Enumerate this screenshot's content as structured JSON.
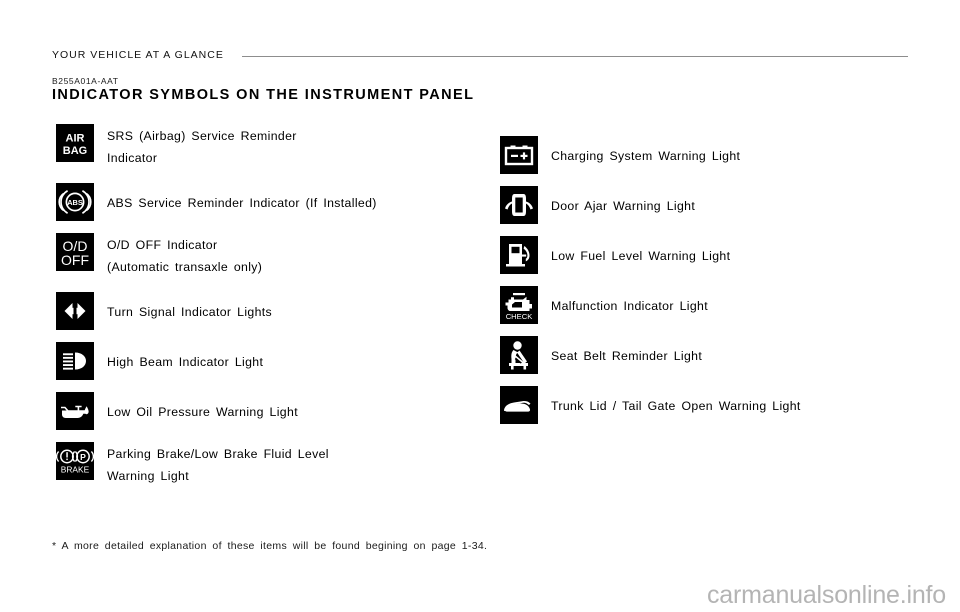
{
  "header": {
    "running_head": "YOUR VEHICLE AT A GLANCE",
    "section_code": "B255A01A-AAT",
    "section_title": "INDICATOR  SYMBOLS  ON  THE  INSTRUMENT  PANEL"
  },
  "left_column": [
    {
      "icon": "air-bag-icon",
      "icon_text_line1": "AIR",
      "icon_text_line2": "BAG",
      "label": "SRS  (Airbag)  Service  Reminder\nIndicator",
      "lines": 2
    },
    {
      "icon": "abs-icon",
      "icon_text_line1": "ABS",
      "label": "ABS  Service  Reminder  Indicator  (If  Installed)",
      "lines": 1
    },
    {
      "icon": "od-off-icon",
      "icon_text_line1": "O/D",
      "icon_text_line2": "OFF",
      "label": "O/D  OFF  Indicator\n(Automatic  transaxle  only)",
      "lines": 2
    },
    {
      "icon": "turn-signal-icon",
      "label": "Turn  Signal  Indicator  Lights",
      "lines": 1
    },
    {
      "icon": "high-beam-icon",
      "label": "High  Beam  Indicator  Light",
      "lines": 1
    },
    {
      "icon": "low-oil-pressure-icon",
      "label": "Low  Oil  Pressure  Warning  Light",
      "lines": 1
    },
    {
      "icon": "parking-brake-icon",
      "icon_text_line1": "BRAKE",
      "label": "Parking  Brake/Low  Brake  Fluid  Level\nWarning  Light",
      "lines": 2
    }
  ],
  "right_column": [
    {
      "icon": "charging-system-icon",
      "label": "Charging  System  Warning  Light",
      "lines": 1
    },
    {
      "icon": "door-ajar-icon",
      "label": "Door  Ajar  Warning  Light",
      "lines": 1
    },
    {
      "icon": "low-fuel-icon",
      "label": "Low  Fuel  Level  Warning  Light",
      "lines": 1
    },
    {
      "icon": "malfunction-indicator-icon",
      "icon_text_line1": "CHECK",
      "label": "Malfunction  Indicator  Light",
      "lines": 1
    },
    {
      "icon": "seat-belt-icon",
      "label": "Seat  Belt  Reminder  Light",
      "lines": 1
    },
    {
      "icon": "trunk-lid-icon",
      "label": "Trunk  Lid  /  Tail  Gate  Open  Warning  Light",
      "lines": 1
    }
  ],
  "footnote": "*  A  more  detailed  explanation  of  these  items  will  be  found  begining  on  page  1-34.",
  "watermark": "carmanualsonline.info",
  "colors": {
    "icon_background": "#000000",
    "icon_foreground": "#ffffff",
    "rule": "#8d8d8d",
    "watermark": "#b4b4b4",
    "text": "#000000"
  }
}
